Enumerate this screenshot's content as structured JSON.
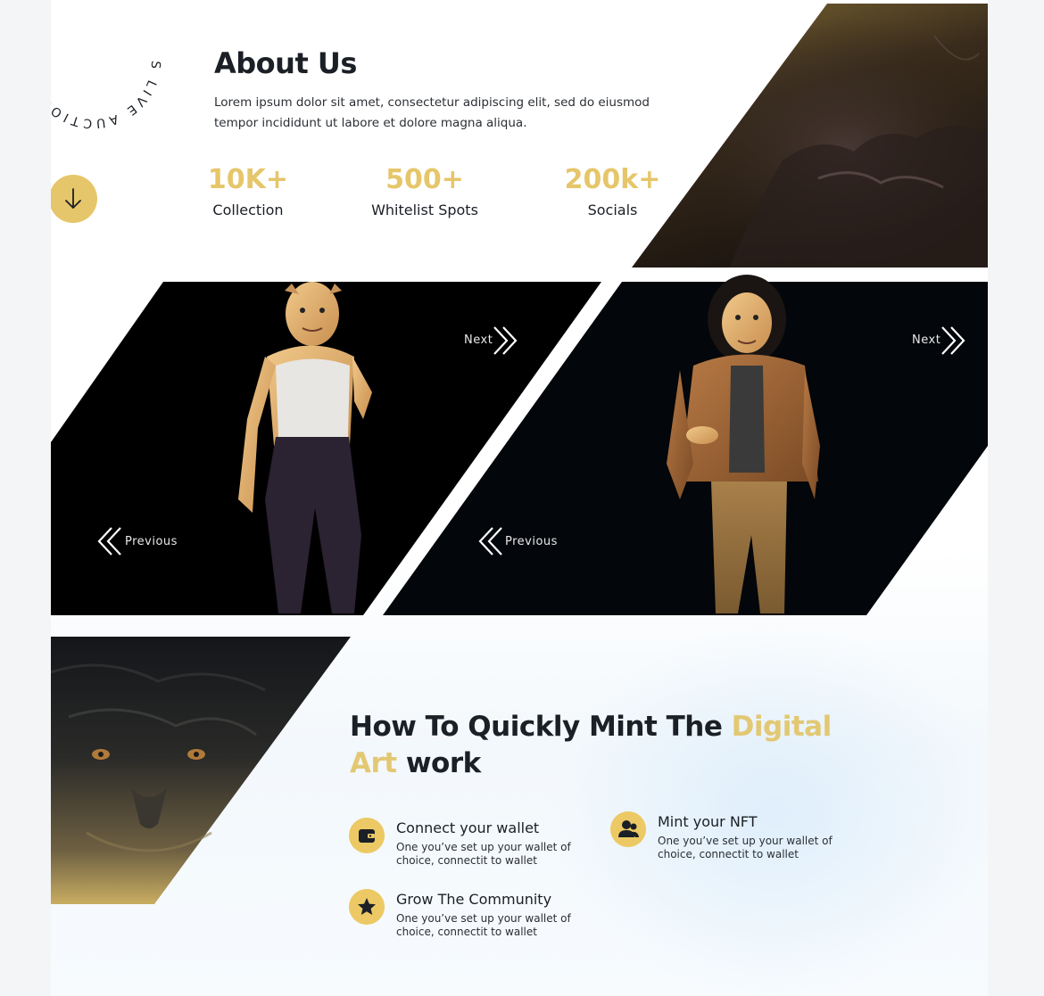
{
  "about": {
    "title": "About Us",
    "description": "Lorem ipsum dolor sit amet, consectetur adipiscing elit, sed do eiusmod tempor incididunt ut labore et dolore magna aliqua."
  },
  "badge": {
    "ring_text": "LIVE AUCTIONS NFTS LIVE AUCTIONS NFTS",
    "icon": "arrow-down-icon"
  },
  "stats": [
    {
      "value": "10K+",
      "label": "Collection"
    },
    {
      "value": "500+",
      "label": "Whitelist Spots"
    },
    {
      "value": "200k+",
      "label": "Socials"
    }
  ],
  "sliders": [
    {
      "next_label": "Next",
      "previous_label": "Previous",
      "character": "lioness-character"
    },
    {
      "next_label": "Next",
      "previous_label": "Previous",
      "character": "lion-character"
    }
  ],
  "mint": {
    "title_part1": "How To Quickly Mint The ",
    "title_accent": "Digital Art",
    "title_part2": " work"
  },
  "steps": [
    {
      "title": "Connect your wallet",
      "description": "One you’ve set up your wallet of choice, connectit to wallet",
      "icon": "wallet-icon"
    },
    {
      "title": "Mint your NFT",
      "description": "One you’ve set up your wallet of choice, connectit to wallet",
      "icon": "users-icon"
    },
    {
      "title": "Grow The Community",
      "description": "One you’ve set up your wallet of choice, connectit to wallet",
      "icon": "star-icon"
    }
  ],
  "colors": {
    "accent": "#e6c66a",
    "text_dark": "#1b1f26",
    "panel_black": "#000000"
  }
}
